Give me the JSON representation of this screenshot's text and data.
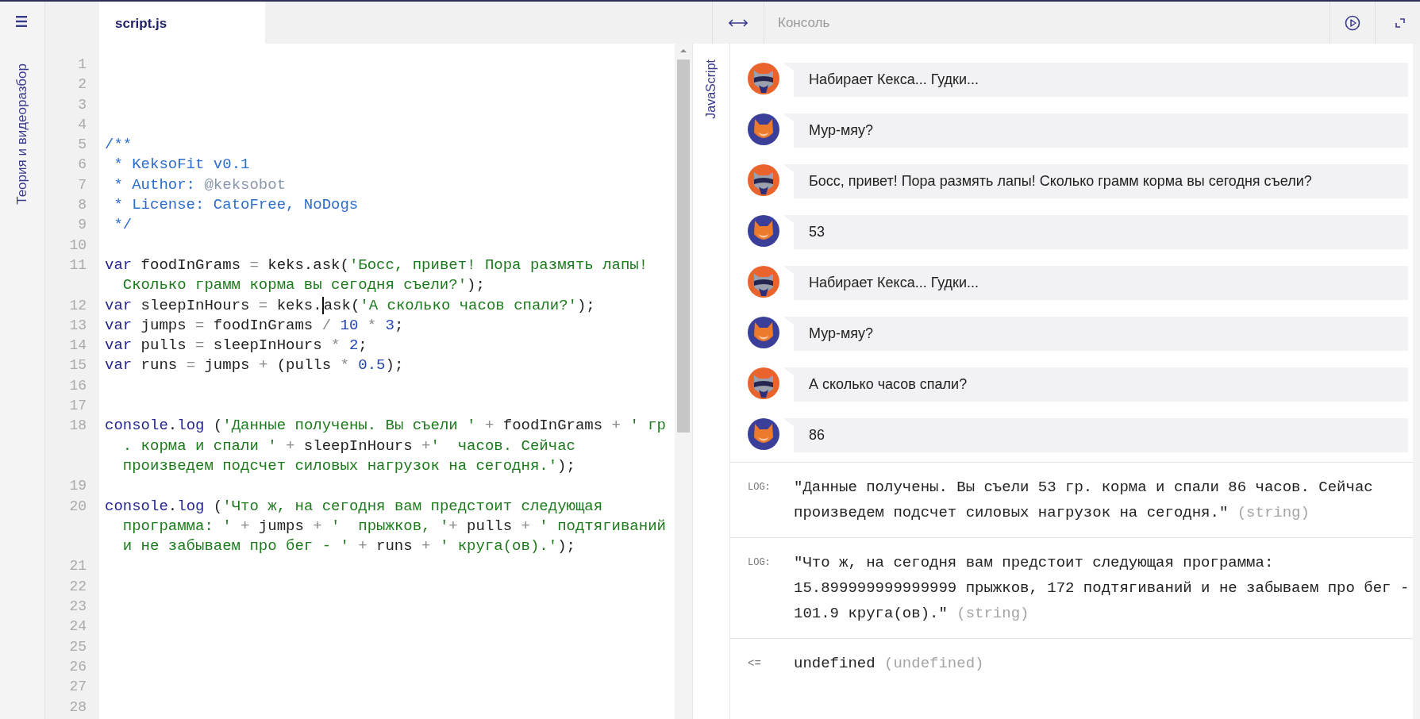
{
  "sidebar": {
    "label": "Теория и видеоразбор"
  },
  "editor": {
    "tab": {
      "label": "script.js",
      "selected": true
    },
    "lines": [
      {
        "number": "1"
      },
      {
        "number": "2"
      },
      {
        "number": "3"
      },
      {
        "number": "4"
      },
      {
        "number": "5",
        "rows": [
          {
            "segments": [
              {
                "kind": "comment",
                "text": "/**"
              }
            ]
          }
        ]
      },
      {
        "number": "6",
        "rows": [
          {
            "segments": [
              {
                "kind": "comment",
                "text": " * KeksoFit v0.1"
              }
            ]
          }
        ]
      },
      {
        "number": "7",
        "rows": [
          {
            "segments": [
              {
                "kind": "comment",
                "text": " * Author: "
              },
              {
                "kind": "tag",
                "text": "@keksobot"
              }
            ]
          }
        ]
      },
      {
        "number": "8",
        "rows": [
          {
            "segments": [
              {
                "kind": "comment",
                "text": " * License: CatoFree, NoDogs"
              }
            ]
          }
        ]
      },
      {
        "number": "9",
        "rows": [
          {
            "segments": [
              {
                "kind": "comment",
                "text": " */"
              }
            ]
          }
        ]
      },
      {
        "number": "10"
      },
      {
        "number": "11",
        "rows": [
          {
            "segments": [
              {
                "kind": "keyword",
                "text": "var"
              },
              {
                "kind": "plain",
                "text": " foodInGrams "
              },
              {
                "kind": "op",
                "text": "="
              },
              {
                "kind": "plain",
                "text": " keks.ask("
              },
              {
                "kind": "string",
                "text": "'Босс, привет! Пора размять лапы!"
              }
            ]
          },
          {
            "segments": [
              {
                "kind": "string",
                "text": "Сколько грамм корма вы сегодня съели?'"
              },
              {
                "kind": "plain",
                "text": ");"
              }
            ]
          }
        ]
      },
      {
        "number": "12",
        "rows": [
          {
            "segments": [
              {
                "kind": "keyword",
                "text": "var"
              },
              {
                "kind": "plain",
                "text": " sleepInHours "
              },
              {
                "kind": "op",
                "text": "="
              },
              {
                "kind": "plain",
                "text": " keks."
              },
              {
                "kind": "plain",
                "text": "ask(",
                "caret_before": true
              },
              {
                "kind": "string",
                "text": "'А сколько часов спали?'"
              },
              {
                "kind": "plain",
                "text": ");"
              }
            ]
          }
        ]
      },
      {
        "number": "13",
        "rows": [
          {
            "segments": [
              {
                "kind": "keyword",
                "text": "var"
              },
              {
                "kind": "plain",
                "text": " jumps "
              },
              {
                "kind": "op",
                "text": "="
              },
              {
                "kind": "plain",
                "text": " foodInGrams "
              },
              {
                "kind": "op",
                "text": "/"
              },
              {
                "kind": "number",
                "text": " 10"
              },
              {
                "kind": "op",
                "text": " *"
              },
              {
                "kind": "number",
                "text": " 3"
              },
              {
                "kind": "plain",
                "text": ";"
              }
            ]
          }
        ]
      },
      {
        "number": "14",
        "rows": [
          {
            "segments": [
              {
                "kind": "keyword",
                "text": "var"
              },
              {
                "kind": "plain",
                "text": " pulls "
              },
              {
                "kind": "op",
                "text": "="
              },
              {
                "kind": "plain",
                "text": " sleepInHours "
              },
              {
                "kind": "op",
                "text": "*"
              },
              {
                "kind": "number",
                "text": " 2"
              },
              {
                "kind": "plain",
                "text": ";"
              }
            ]
          }
        ]
      },
      {
        "number": "15",
        "rows": [
          {
            "segments": [
              {
                "kind": "keyword",
                "text": "var"
              },
              {
                "kind": "plain",
                "text": " runs "
              },
              {
                "kind": "op",
                "text": "="
              },
              {
                "kind": "plain",
                "text": " jumps "
              },
              {
                "kind": "op",
                "text": "+"
              },
              {
                "kind": "plain",
                "text": " (pulls "
              },
              {
                "kind": "op",
                "text": "*"
              },
              {
                "kind": "number",
                "text": " 0.5"
              },
              {
                "kind": "plain",
                "text": ");"
              }
            ]
          }
        ]
      },
      {
        "number": "16"
      },
      {
        "number": "17"
      },
      {
        "number": "18",
        "rows": [
          {
            "segments": [
              {
                "kind": "builtin",
                "text": "console"
              },
              {
                "kind": "plain",
                "text": "."
              },
              {
                "kind": "builtin",
                "text": "log"
              },
              {
                "kind": "plain",
                "text": " ("
              },
              {
                "kind": "string",
                "text": "'Данные получены. Вы съели '"
              },
              {
                "kind": "op",
                "text": " +"
              },
              {
                "kind": "plain",
                "text": " foodInGrams "
              },
              {
                "kind": "op",
                "text": "+"
              },
              {
                "kind": "string",
                "text": " ' гр"
              }
            ]
          },
          {
            "segments": [
              {
                "kind": "string",
                "text": ". корма и спали '"
              },
              {
                "kind": "op",
                "text": " +"
              },
              {
                "kind": "plain",
                "text": " sleepInHours "
              },
              {
                "kind": "op",
                "text": "+"
              },
              {
                "kind": "string",
                "text": "'  часов. Сейчас"
              }
            ]
          },
          {
            "segments": [
              {
                "kind": "string",
                "text": "произведем подсчет силовых нагрузок на сегодня.'"
              },
              {
                "kind": "plain",
                "text": ");"
              }
            ]
          }
        ]
      },
      {
        "number": "19"
      },
      {
        "number": "20",
        "rows": [
          {
            "segments": [
              {
                "kind": "builtin",
                "text": "console"
              },
              {
                "kind": "plain",
                "text": "."
              },
              {
                "kind": "builtin",
                "text": "log"
              },
              {
                "kind": "plain",
                "text": " ("
              },
              {
                "kind": "string",
                "text": "'Что ж, на сегодня вам предстоит следующая"
              }
            ]
          },
          {
            "segments": [
              {
                "kind": "string",
                "text": "программа: '"
              },
              {
                "kind": "op",
                "text": " +"
              },
              {
                "kind": "plain",
                "text": " jumps "
              },
              {
                "kind": "op",
                "text": "+"
              },
              {
                "kind": "string",
                "text": " '  прыжков, '"
              },
              {
                "kind": "op",
                "text": "+"
              },
              {
                "kind": "plain",
                "text": " pulls "
              },
              {
                "kind": "op",
                "text": "+"
              },
              {
                "kind": "string",
                "text": " ' подтягиваний"
              }
            ]
          },
          {
            "segments": [
              {
                "kind": "string",
                "text": "и не забываем про бег - '"
              },
              {
                "kind": "op",
                "text": " +"
              },
              {
                "kind": "plain",
                "text": " runs "
              },
              {
                "kind": "op",
                "text": "+"
              },
              {
                "kind": "string",
                "text": " ' круга(ов).'"
              },
              {
                "kind": "plain",
                "text": ");"
              }
            ]
          }
        ]
      },
      {
        "number": "21"
      },
      {
        "number": "22"
      },
      {
        "number": "23"
      },
      {
        "number": "24"
      },
      {
        "number": "25"
      },
      {
        "number": "26"
      },
      {
        "number": "27"
      },
      {
        "number": "28"
      }
    ]
  },
  "console": {
    "title": "Консоль",
    "language": "JavaScript",
    "messages": [
      {
        "kind": "raccoon",
        "text": "Набирает Кекса... Гудки..."
      },
      {
        "kind": "cat",
        "text": "Мур-мяу?"
      },
      {
        "kind": "raccoon",
        "text": "Босс, привет! Пора размять лапы! Сколько грамм корма вы сегодня съели?"
      },
      {
        "kind": "cat",
        "text": "53"
      },
      {
        "kind": "raccoon",
        "text": "Набирает Кекса... Гудки..."
      },
      {
        "kind": "cat",
        "text": "Мур-мяу?"
      },
      {
        "kind": "raccoon",
        "text": "А сколько часов спали?"
      },
      {
        "kind": "cat",
        "text": "86"
      }
    ],
    "output": [
      {
        "kind": "log",
        "label": "LOG:",
        "text": "\"Данные получены. Вы съели 53 гр. корма и спали 86 часов. Сейчас произведем подсчет силовых нагрузок на сегодня.\"",
        "type": "(string)"
      },
      {
        "kind": "log",
        "label": "LOG:",
        "text": "\"Что ж, на сегодня вам предстоит следующая программа: 15.899999999999999 прыжков, 172 подтягиваний и не забываем про бег - 101.9 круга(ов).\"",
        "type": "(string)"
      },
      {
        "kind": "result",
        "label": "<=",
        "text": "undefined",
        "type": "(undefined)"
      }
    ]
  }
}
